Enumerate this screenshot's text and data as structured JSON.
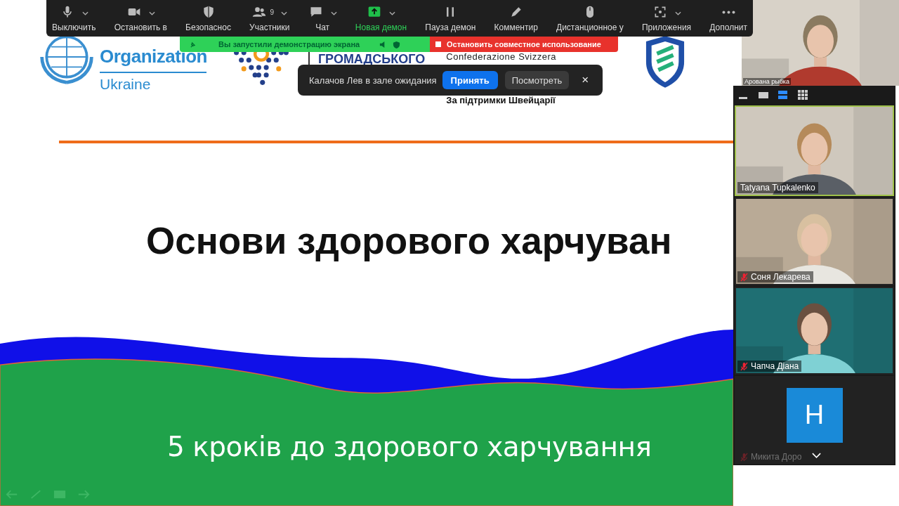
{
  "slide": {
    "who": {
      "lines": [
        "Organization"
      ],
      "country": "Ukraine"
    },
    "center_logo": {
      "lines": [
        "ГРОМАДСЬКОГО"
      ]
    },
    "swiss": {
      "lines": [
        "Confederazione Svizzera"
      ],
      "support": "За підтримки Швейцарії"
    },
    "title": "Основи здорового харчуван",
    "subtitle": "5 кроків до здорового харчування"
  },
  "toolbar": [
    {
      "kind": "mic",
      "label": "Выключить",
      "caret": true,
      "active": false
    },
    {
      "kind": "video",
      "label": "Остановить в",
      "caret": true,
      "active": false
    },
    {
      "kind": "shield",
      "label": "Безопаснос",
      "caret": false,
      "active": false
    },
    {
      "kind": "people",
      "label": "Участники",
      "count": "9",
      "caret": true,
      "active": false
    },
    {
      "kind": "chat",
      "label": "Чат",
      "caret": true,
      "active": false
    },
    {
      "kind": "share",
      "label": "Новая демон",
      "caret": true,
      "active": true
    },
    {
      "kind": "pause",
      "label": "Пауза демон",
      "caret": false,
      "active": false
    },
    {
      "kind": "pen",
      "label": "Комментир",
      "caret": false,
      "active": false
    },
    {
      "kind": "mouse",
      "label": "Дистанционное у",
      "caret": false,
      "active": false
    },
    {
      "kind": "apps",
      "label": "Приложения",
      "caret": true,
      "active": false
    },
    {
      "kind": "more",
      "label": "Дополнит",
      "caret": false,
      "active": false
    }
  ],
  "share_banner": {
    "message": "Вы запустили демонстрацию экрана",
    "stop": "Остановить совместное использование"
  },
  "waiting_toast": {
    "message": "Калачов Лев в зале ожидания",
    "accept": "Принять",
    "view": "Посмотреть",
    "close": "×"
  },
  "speaker": {
    "name": "Арована рыбка"
  },
  "view_modes": [
    {
      "kind": "minimize",
      "selected": false
    },
    {
      "kind": "single",
      "selected": false
    },
    {
      "kind": "strip",
      "selected": true
    },
    {
      "kind": "grid",
      "selected": false
    }
  ],
  "participants": [
    {
      "kind": "video",
      "name": "Tatyana Tupkalenko",
      "muted": false,
      "active": true
    },
    {
      "kind": "video",
      "name": "Соня Лекарева",
      "muted": true,
      "active": false
    },
    {
      "kind": "video",
      "name": "Чапча Діана",
      "muted": true,
      "active": false
    },
    {
      "kind": "avatar",
      "initial": "H",
      "name": "Микита Доро",
      "muted": true,
      "active": false
    }
  ]
}
